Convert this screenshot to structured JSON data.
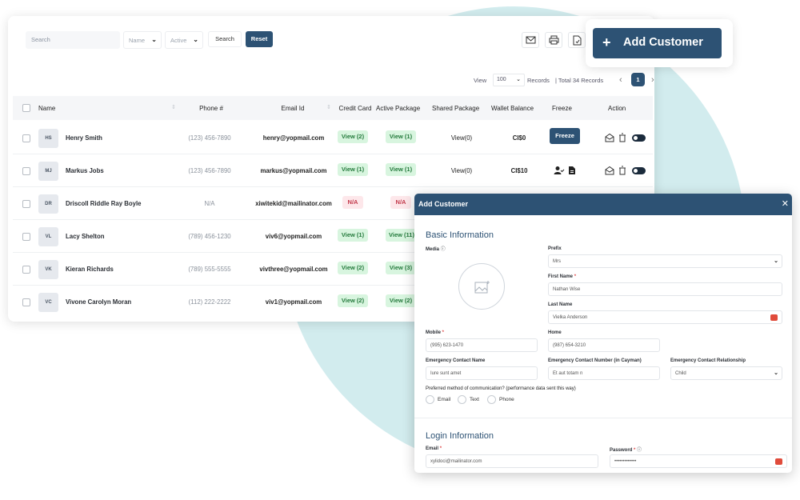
{
  "toolbar": {
    "search_placeholder": "Search",
    "filter_name": "Name",
    "filter_status": "Active",
    "search_label": "Search",
    "reset_label": "Reset",
    "icons": [
      "email-icon",
      "print-icon",
      "export-file-icon"
    ]
  },
  "pager": {
    "view_label": "View",
    "per_page": "100",
    "records_label": "Records",
    "total": "| Total 34 Records",
    "current_page": "1"
  },
  "columns": [
    "Name",
    "Phone #",
    "Email Id",
    "Credit Card",
    "Active Package",
    "Shared Package",
    "Wallet Balance",
    "Freeze",
    "Action"
  ],
  "rows": [
    {
      "initials": "HS",
      "name": "Henry Smith",
      "phone": "(123) 456-7890",
      "email": "henry@yopmail.com",
      "credit": "View (2)",
      "active": "View (1)",
      "shared": "View(0)",
      "wallet": "CI$0",
      "freeze": "Freeze"
    },
    {
      "initials": "MJ",
      "name": "Markus Jobs",
      "phone": "(123) 456-7890",
      "email": "markus@yopmail.com",
      "credit": "View (1)",
      "active": "View (1)",
      "shared": "View(0)",
      "wallet": "CI$10",
      "freeze": ""
    },
    {
      "initials": "DR",
      "name": "Driscoll Riddle Ray Boyle",
      "phone": "N/A",
      "email": "xiwitekid@mailinator.com",
      "credit": "N/A",
      "active": "N/A",
      "shared": "",
      "wallet": "",
      "freeze": ""
    },
    {
      "initials": "VL",
      "name": "Lacy Shelton",
      "phone": "(789) 456-1230",
      "email": "viv6@yopmail.com",
      "credit": "View (1)",
      "active": "View (11)",
      "shared": "",
      "wallet": "",
      "freeze": ""
    },
    {
      "initials": "VK",
      "name": "Kieran Richards",
      "phone": "(789) 555-5555",
      "email": "vivthree@yopmail.com",
      "credit": "View (2)",
      "active": "View (3)",
      "shared": "",
      "wallet": "",
      "freeze": ""
    },
    {
      "initials": "VC",
      "name": "Vivone Carolyn Moran",
      "phone": "(112) 222-2222",
      "email": "viv1@yopmail.com",
      "credit": "View (2)",
      "active": "View (2)",
      "shared": "",
      "wallet": "",
      "freeze": ""
    }
  ],
  "add_customer_button": "Add Customer",
  "modal": {
    "title": "Add Customer",
    "basic_info": "Basic Information",
    "media_label": "Media",
    "prefix_label": "Prefix",
    "prefix_value": "Mrs",
    "first_name_label": "First Name",
    "first_name_value": "Nathan Wise",
    "last_name_label": "Last Name",
    "last_name_value": "Vielka Anderson",
    "mobile_label": "Mobile",
    "mobile_value": "(995) 623-1470",
    "home_label": "Home",
    "home_value": "(987) 654-3210",
    "ec_name_label": "Emergency Contact Name",
    "ec_name_value": "Iure sunt amet",
    "ec_number_label": "Emergency Contact Number (in Cayman)",
    "ec_number_value": "Et aut totam n",
    "ec_rel_label": "Emergency Contact Relationship",
    "ec_rel_value": "Child",
    "preferred_label": "Preferred method of communication? (performance data sent this way)",
    "opt_email": "Email",
    "opt_text": "Text",
    "opt_phone": "Phone",
    "login_info": "Login Information",
    "email_label": "Email",
    "email_value": "xylidoci@mailinator.com",
    "password_label": "Password",
    "password_value": "•••••••••••••"
  },
  "colors": {
    "primary": "#2d5274",
    "accent_bg": "#d2ecee",
    "pill_green": "#d8f5df",
    "pill_red": "#fde7ea"
  }
}
